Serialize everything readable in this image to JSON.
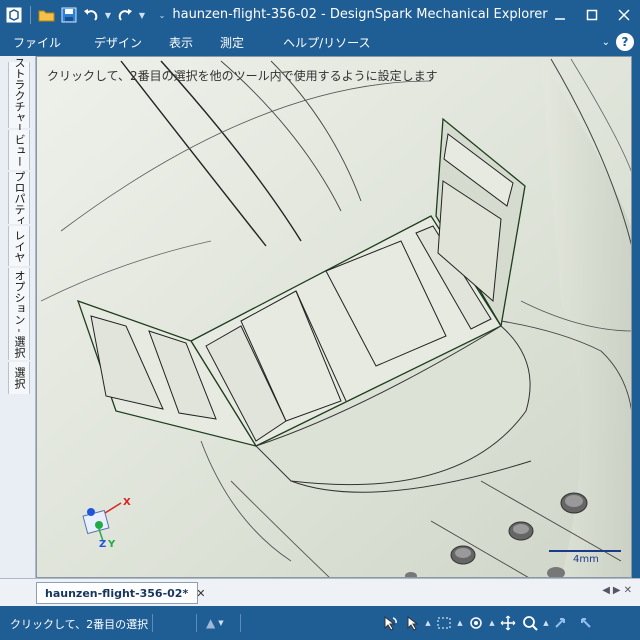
{
  "window": {
    "title": "haunzen-flight-356-02 - DesignSpark Mechanical Explorer"
  },
  "menu": {
    "items": [
      "ファイル",
      "デザイン",
      "表示",
      "測定",
      "ヘルプ/リソース"
    ]
  },
  "side_tabs": [
    "ストラクチャー",
    "ビュー",
    "プロパティ",
    "レイヤ",
    "オプション - 選択",
    "選択"
  ],
  "viewport": {
    "hint": "クリックして、2番目の選択を他のツール内で使用するように設定します",
    "scale_label": "4mm",
    "triad": {
      "x": "X",
      "y": "Y",
      "z": "Z"
    }
  },
  "document_tab": {
    "name": "haunzen-flight-356-02*",
    "close": "✕"
  },
  "status": {
    "message": "クリックして、2番目の選択"
  },
  "colors": {
    "chrome": "#1f5d95",
    "viewport_bg": "#dfe4da"
  }
}
